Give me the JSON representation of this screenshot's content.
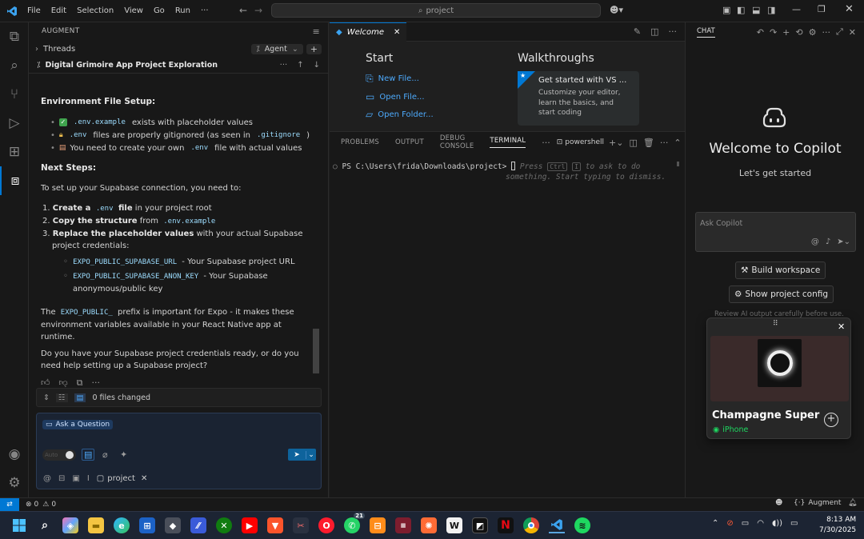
{
  "titlebar": {
    "menu": [
      "File",
      "Edit",
      "Selection",
      "View",
      "Go",
      "Run",
      "···"
    ],
    "search_text": "project"
  },
  "augment": {
    "panel_title": "AUGMENT",
    "threads_label": "Threads",
    "agent_label": "Agent",
    "thread_title": "Digital Grimoire App Project Exploration",
    "env_heading": "Environment File Setup:",
    "bullets": [
      {
        "code": ".env.example",
        "text": " exists with placeholder values"
      },
      {
        "code": ".env",
        "text": " files are properly gitignored (as seen in ",
        "code2": ".gitignore",
        "text2": ")"
      },
      {
        "text_pre": "You need to create your own ",
        "code": ".env",
        "text": " file with actual values"
      }
    ],
    "next_heading": "Next Steps:",
    "intro": "To set up your Supabase connection, you need to:",
    "steps": [
      {
        "num": "1.",
        "bold": "Create a ",
        "code": ".env",
        "bold2": " file",
        "rest": " in your project root"
      },
      {
        "num": "2.",
        "bold": "Copy the structure",
        "rest": " from ",
        "code": ".env.example"
      },
      {
        "num": "3.",
        "bold": "Replace the placeholder values",
        "rest": " with your actual Supabase project credentials:"
      }
    ],
    "subitems": [
      {
        "code": "EXPO_PUBLIC_SUPABASE_URL",
        "text": " - Your Supabase project URL"
      },
      {
        "code": "EXPO_PUBLIC_SUPABASE_ANON_KEY",
        "text": " - Your Supabase anonymous/public key"
      }
    ],
    "note_pre": "The ",
    "note_code": "EXPO_PUBLIC_",
    "note_post": " prefix is important for Expo - it makes these environment variables available in your React Native app at runtime.",
    "question": "Do you have your Supabase project credentials ready, or do you need help setting up a Supabase project?",
    "files_changed": "0 files changed",
    "ask_label": "Ask a Question",
    "auto_label": "Auto",
    "context_chip": "project"
  },
  "editor": {
    "tab_label": "Welcome",
    "start_heading": "Start",
    "start_links": [
      "New File...",
      "Open File...",
      "Open Folder..."
    ],
    "walkthroughs_heading": "Walkthroughs",
    "walkthrough_title": "Get started with VS ...",
    "walkthrough_desc": "Customize your editor, learn the basics, and start coding",
    "panel_tabs": [
      "PROBLEMS",
      "OUTPUT",
      "DEBUG CONSOLE",
      "TERMINAL"
    ],
    "shell_label": "powershell",
    "terminal_prompt": "PS C:\\Users\\frida\\Downloads\\project>",
    "terminal_hint_1": "Press",
    "terminal_key_1": "Ctrl",
    "terminal_key_2": "I",
    "terminal_hint_2": "to ask to do",
    "terminal_hint_3": "something. Start typing to dismiss."
  },
  "chat": {
    "title": "CHAT",
    "welcome": "Welcome to Copilot",
    "subtitle": "Let's get started",
    "input_placeholder": "Ask Copilot",
    "build_button": "Build workspace",
    "config_button": "Show project config",
    "review_note": "Review AI output carefully before use."
  },
  "media": {
    "song": "Champagne Super",
    "device": "iPhone"
  },
  "statusbar": {
    "errors": "0",
    "warnings": "0",
    "augment_label": "Augment"
  },
  "taskbar": {
    "time": "8:13 AM",
    "date": "7/30/2025",
    "badge": "21"
  },
  "colors": {
    "accent": "#0078d4",
    "link": "#4daafc",
    "spotify_green": "#1ed760"
  }
}
